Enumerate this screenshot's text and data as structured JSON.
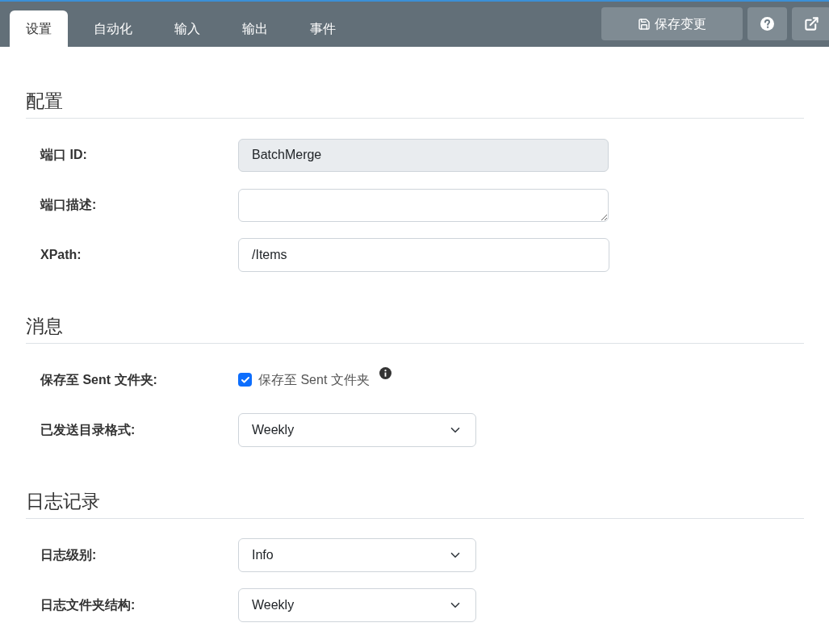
{
  "tabs": [
    {
      "label": "设置",
      "selected": true
    },
    {
      "label": "自动化",
      "selected": false
    },
    {
      "label": "输入",
      "selected": false
    },
    {
      "label": "输出",
      "selected": false
    },
    {
      "label": "事件",
      "selected": false
    }
  ],
  "toolbar": {
    "save_label": "保存变更"
  },
  "sections": [
    {
      "title": "配置",
      "rows": [
        {
          "kind": "readonly",
          "label": "端口 ID:",
          "value": "BatchMerge"
        },
        {
          "kind": "textarea",
          "label": "端口描述:"
        },
        {
          "kind": "input",
          "label": "XPath:",
          "value": "/Items"
        }
      ]
    },
    {
      "title": "消息",
      "rows": [
        {
          "kind": "checkbox",
          "label": "保存至 Sent 文件夹:",
          "text": "保存至 Sent 文件夹",
          "checked": true
        },
        {
          "kind": "select",
          "label": "已发送目录格式:",
          "value": "Weekly"
        }
      ]
    },
    {
      "title": "日志记录",
      "rows": [
        {
          "kind": "select",
          "label": "日志级别:",
          "value": "Info"
        },
        {
          "kind": "select",
          "label": "日志文件夹结构:",
          "value": "Weekly"
        }
      ]
    }
  ]
}
